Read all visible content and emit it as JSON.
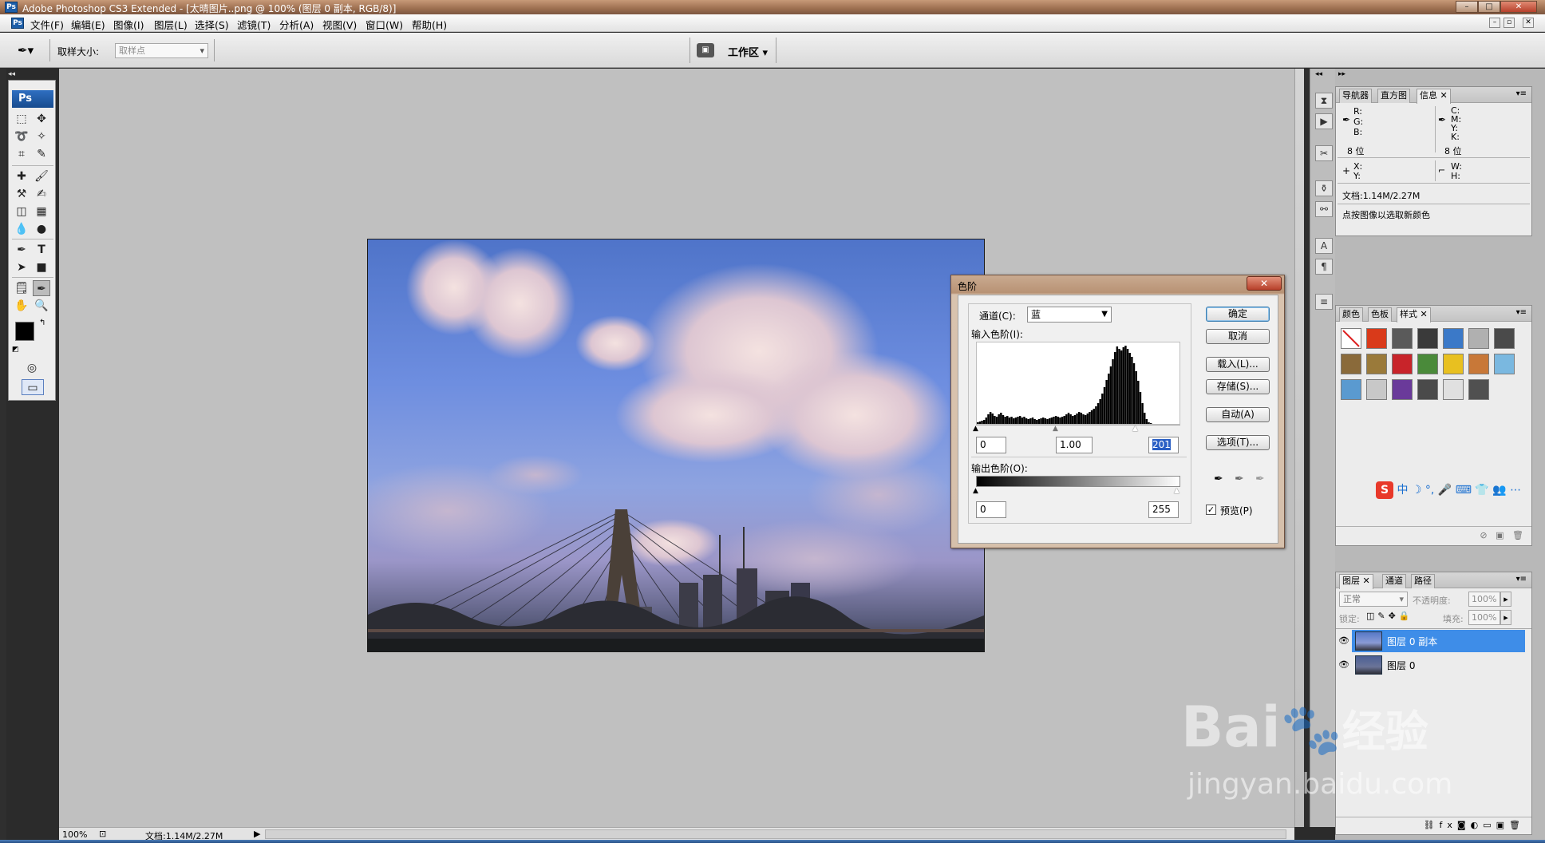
{
  "window": {
    "title": "Adobe Photoshop CS3 Extended - [太晴图片..png @ 100% (图层 0 副本, RGB/8)]"
  },
  "menubar": {
    "items": [
      "文件(F)",
      "编辑(E)",
      "图像(I)",
      "图层(L)",
      "选择(S)",
      "滤镜(T)",
      "分析(A)",
      "视图(V)",
      "窗口(W)",
      "帮助(H)"
    ]
  },
  "options": {
    "sample_size_label": "取样大小:",
    "sample_size_value": "取样点",
    "workspace_label": "工作区 ▾"
  },
  "toolbar": {
    "logo": "Ps",
    "tools": [
      "marquee",
      "move",
      "lasso",
      "magic-wand",
      "crop",
      "slice",
      "healing",
      "brush",
      "stamp",
      "history-brush",
      "eraser",
      "gradient",
      "blur",
      "dodge",
      "pen",
      "type",
      "path-select",
      "shape",
      "notes",
      "eyedropper",
      "hand",
      "zoom"
    ]
  },
  "levels_dialog": {
    "title": "色阶",
    "channel_label": "通道(C):",
    "channel_value": "蓝",
    "input_levels_label": "输入色阶(I):",
    "input_values": [
      "0",
      "1.00",
      "201"
    ],
    "output_levels_label": "输出色阶(O):",
    "output_values": [
      "0",
      "255"
    ],
    "buttons": [
      "确定",
      "取消",
      "载入(L)...",
      "存储(S)...",
      "自动(A)",
      "选项(T)..."
    ],
    "preview_label": "预览(P)",
    "preview_checked": true,
    "histogram": [
      2,
      3,
      4,
      5,
      8,
      12,
      15,
      13,
      10,
      9,
      12,
      14,
      11,
      9,
      10,
      8,
      9,
      7,
      8,
      9,
      10,
      8,
      9,
      7,
      6,
      7,
      8,
      6,
      5,
      6,
      7,
      8,
      7,
      6,
      7,
      8,
      9,
      10,
      9,
      8,
      9,
      10,
      12,
      14,
      12,
      10,
      11,
      13,
      15,
      14,
      12,
      11,
      13,
      15,
      17,
      19,
      22,
      26,
      31,
      38,
      46,
      55,
      63,
      72,
      81,
      90,
      97,
      94,
      92,
      96,
      98,
      94,
      89,
      84,
      76,
      66,
      54,
      40,
      26,
      14,
      6,
      2,
      1,
      0,
      0,
      0,
      0,
      0,
      0,
      0,
      0,
      0,
      0,
      0,
      0,
      0
    ]
  },
  "info_panel": {
    "tabs": [
      "导航器",
      "直方图",
      "信息"
    ],
    "rgb_labels": [
      "R:",
      "G:",
      "B:"
    ],
    "cmyk_labels": [
      "C:",
      "M:",
      "Y:",
      "K:"
    ],
    "bit_depth": "8 位",
    "xy_labels": [
      "X:",
      "Y:"
    ],
    "wh_labels": [
      "W:",
      "H:"
    ],
    "doc_size": "文档:1.14M/2.27M",
    "hint": "点按图像以选取新颜色"
  },
  "styles_panel": {
    "tabs": [
      "颜色",
      "色板",
      "样式"
    ],
    "swatches": [
      "#ffffff",
      "#d93a1a",
      "#5a5a5a",
      "#3a3a3a",
      "#3b79c8",
      "#b0b0b0",
      "#4a4a4a",
      "#8a6a3a",
      "#9a7a3a",
      "#c8242a",
      "#4a8a3a",
      "#e8c020",
      "#c87838",
      "#7ab8e0",
      "#5a9ad0",
      "#c8c8c8",
      "#6a3a9a",
      "#4a4a4a",
      "#e0e0e0",
      "#505050"
    ]
  },
  "ime_bar": {
    "items": [
      "S",
      "中",
      "☽",
      "°,",
      "🎤",
      "⌨",
      "👕",
      "👥",
      "⋯"
    ]
  },
  "layers_panel": {
    "tabs": [
      "图层",
      "通道",
      "路径"
    ],
    "blend_mode": "正常",
    "opacity_label": "不透明度:",
    "opacity_value": "100%",
    "lock_label": "锁定:",
    "fill_label": "填充:",
    "fill_value": "100%",
    "layers": [
      {
        "name": "图层 0 副本",
        "selected": true
      },
      {
        "name": "图层 0",
        "selected": false
      }
    ]
  },
  "status": {
    "zoom": "100%",
    "doc_size": "文档:1.14M/2.27M"
  },
  "watermark": {
    "brand": "Bai",
    "brand_cn": "经验",
    "url": "jingyan.baidu.com"
  }
}
